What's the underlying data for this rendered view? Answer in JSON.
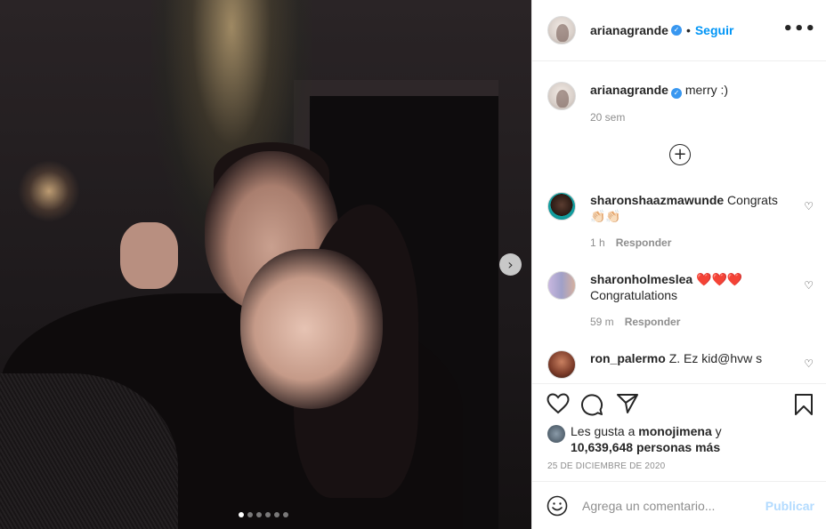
{
  "post": {
    "header": {
      "username": "arianagrande",
      "separator": "•",
      "follow_label": "Seguir",
      "more_label": "•••"
    },
    "carousel": {
      "next_icon": "chevron-right-icon",
      "slides_count": 6,
      "active_index": 0
    },
    "caption": {
      "username": "arianagrande",
      "text": "merry :)",
      "time": "20 sem"
    },
    "load_more_icon": "plus-circle-icon",
    "comments": [
      {
        "username": "sharonshaazmawunde",
        "text": "Congrats",
        "emoji": "👏🏻👏🏻",
        "time": "1 h",
        "reply_label": "Responder"
      },
      {
        "username": "sharonholmeslea",
        "text": "❤️❤️❤️",
        "text2": "Congratulations",
        "time": "59 m",
        "reply_label": "Responder"
      },
      {
        "username": "ron_palermo",
        "text": "Z. Ez kid@hvw s"
      }
    ],
    "likes": {
      "prefix": "Les gusta a",
      "first_user": "monojimena",
      "conj": "y",
      "count_text": "10,639,648 personas más"
    },
    "date": "25 DE DICIEMBRE DE 2020",
    "add_comment": {
      "placeholder": "Agrega un comentario...",
      "publish_label": "Publicar"
    },
    "colors": {
      "accent": "#0095f6",
      "verified": "#3897f0",
      "muted": "#8e8e8e",
      "publish_disabled": "#b3dbff"
    }
  }
}
